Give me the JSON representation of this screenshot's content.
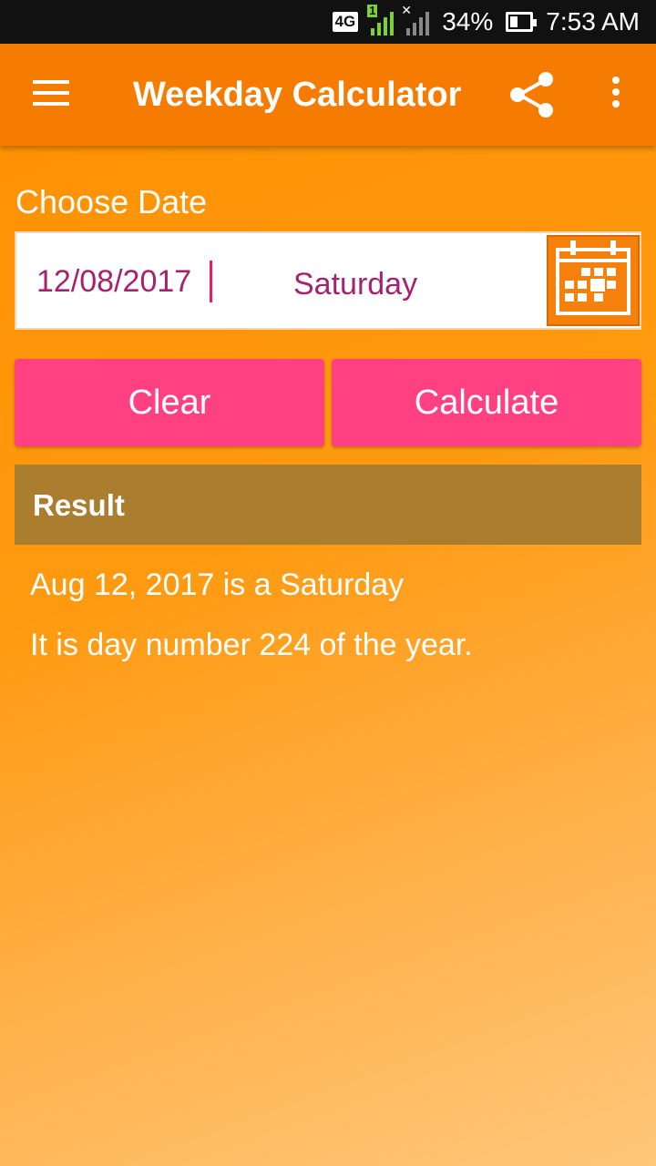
{
  "status_bar": {
    "network": "4G",
    "sim_indicator": "1",
    "battery": "34%",
    "time": "7:53 AM"
  },
  "app_bar": {
    "title": "Weekday Calculator",
    "icons": [
      "menu-icon",
      "share-icon",
      "more-vert-icon"
    ]
  },
  "form": {
    "label": "Choose Date",
    "date_value": "12/08/2017",
    "weekday": "Saturday",
    "calendar_icon": "calendar-icon"
  },
  "buttons": {
    "clear": "Clear",
    "calculate": "Calculate"
  },
  "result": {
    "header": "Result",
    "line1": "Aug 12, 2017 is a Saturday",
    "line2": "It is day number 224 of the year."
  },
  "colors": {
    "app_bar": "#f57c00",
    "accent": "#ff4081",
    "result_header": "#ab7d2e",
    "date_text": "#a5236e"
  }
}
